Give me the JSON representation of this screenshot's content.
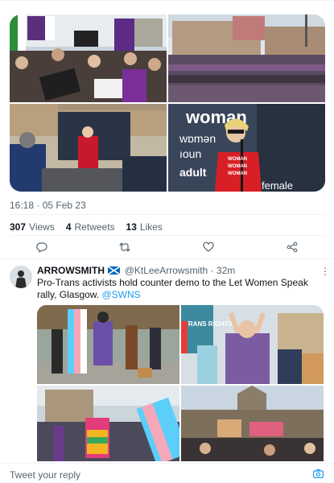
{
  "tweet": {
    "photo_alt": [
      "Rally crowd with placards",
      "Crowd in George Square",
      "Speaker at rally",
      "Speaker in red at microphone"
    ],
    "time": "16:18",
    "date": "05 Feb 23",
    "stats": {
      "views_count": "307",
      "views_label": "Views",
      "retweets_count": "4",
      "retweets_label": "Retweets",
      "likes_count": "13",
      "likes_label": "Likes"
    },
    "placard_texts": [
      "woman",
      "wɒmən",
      "ıoun",
      "adult",
      "female",
      "WOMAN",
      "WOMAN",
      "WOMAN"
    ]
  },
  "reply": {
    "name": "ARROWSMITH",
    "flag_icon": "scotland-flag-icon",
    "handle": "@KtLeeArrowsmith",
    "separator": "·",
    "time": "32m",
    "text": "Pro-Trans activists hold counter demo to the Let Women Speak rally, Glasgow.",
    "mention": "@SWNS",
    "sign_text": "TRANS RIGHTS"
  },
  "composer": {
    "placeholder": "Tweet your reply",
    "camera_icon": "camera-icon"
  },
  "colors": {
    "accent": "#1d9bf0",
    "muted": "#536471",
    "text": "#0f1419",
    "divider": "#eff3f4"
  }
}
